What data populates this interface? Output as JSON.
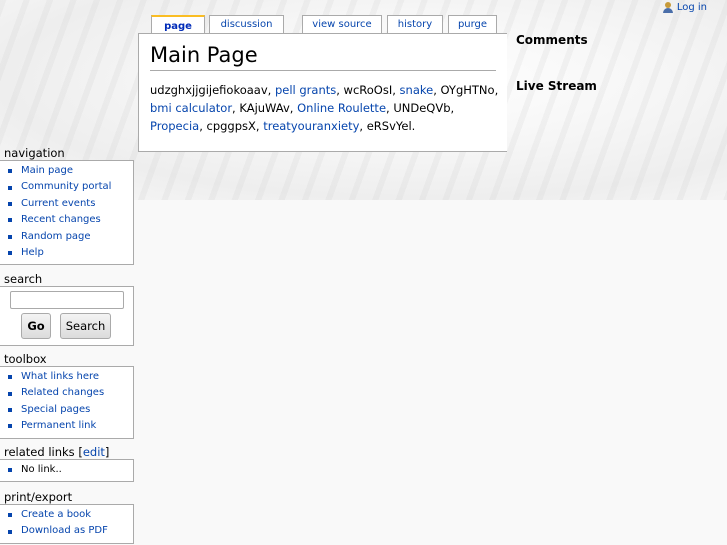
{
  "personal_tools": {
    "login": "Log in"
  },
  "tabs": [
    {
      "label": "page"
    },
    {
      "label": "discussion"
    },
    {
      "label": "view source"
    },
    {
      "label": "history"
    },
    {
      "label": "purge"
    }
  ],
  "content": {
    "title": "Main Page",
    "segments": [
      {
        "text": "udzghxjjgijefiokoaav, "
      },
      {
        "text": "pell grants",
        "link": true
      },
      {
        "text": ", wcRoOsI, "
      },
      {
        "text": "snake",
        "link": true
      },
      {
        "text": ", OYgHTNo, "
      },
      {
        "text": "bmi calculator",
        "link": true
      },
      {
        "text": ", KAjuWAv, "
      },
      {
        "text": "Online Roulette",
        "link": true
      },
      {
        "text": ", UNDeQVb, "
      },
      {
        "text": "Propecia",
        "link": true
      },
      {
        "text": ", cpggpsX, "
      },
      {
        "text": "treatyouranxiety",
        "link": true
      },
      {
        "text": ", eRSvYel."
      }
    ]
  },
  "right_column": {
    "comments": "Comments",
    "live_stream": "Live Stream"
  },
  "sidebar": {
    "navigation": {
      "title": "navigation",
      "items": [
        "Main page",
        "Community portal",
        "Current events",
        "Recent changes",
        "Random page",
        "Help"
      ]
    },
    "search": {
      "title": "search",
      "go": "Go",
      "search": "Search",
      "value": ""
    },
    "toolbox": {
      "title": "toolbox",
      "items": [
        "What links here",
        "Related changes",
        "Special pages",
        "Permanent link"
      ]
    },
    "related_links": {
      "title": "related links",
      "edit": "edit",
      "items": [
        "No link.."
      ]
    },
    "print_export": {
      "title": "print/export",
      "items": [
        "Create a book",
        "Download as PDF"
      ]
    }
  },
  "colors": {
    "link": "#0645ad",
    "tab_selected_accent": "#fabd23",
    "border": "#aaaaaa"
  }
}
